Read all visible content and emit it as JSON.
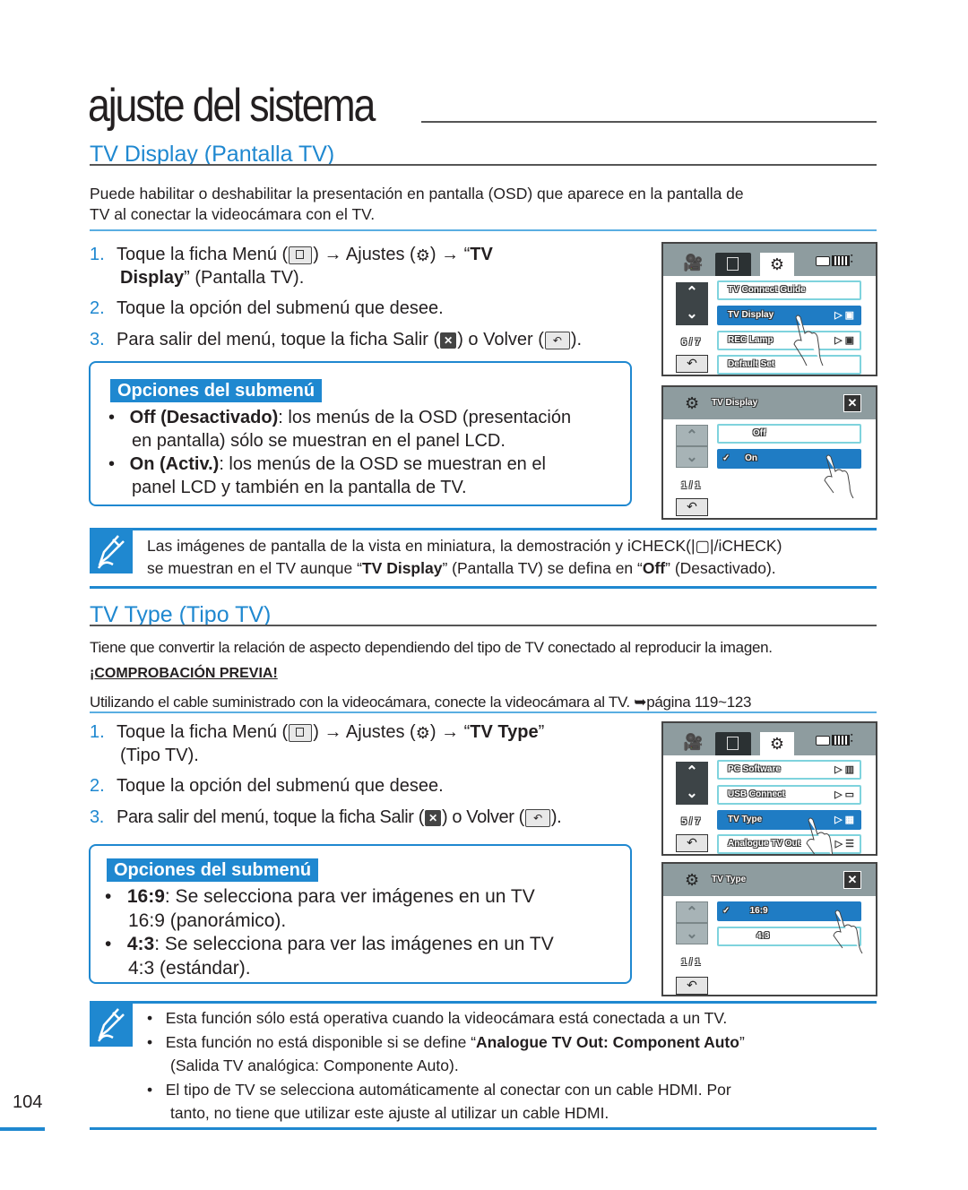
{
  "page": {
    "title": "ajuste del sistema",
    "number": "104"
  },
  "colors": {
    "accent": "#1f88d0",
    "selected": "#1f7cc4",
    "screen_header": "#8e9c9f"
  },
  "tv_display": {
    "title": "TV Display (Pantalla TV)",
    "intro": [
      "Puede habilitar o deshabilitar la presentación en pantalla (OSD) que aparece en la pantalla de",
      "TV al conectar la videocámara con el TV."
    ],
    "steps": [
      {
        "num": "1.",
        "a": "Toque la ficha Menú (",
        "b": ") → Ajustes (",
        "c": ") → “",
        "bold": "TV",
        "line2_bold": "Display",
        "line2": "” (Pantalla TV)."
      },
      {
        "num": "2.",
        "text": "Toque la opción del submenú que desee."
      },
      {
        "num": "3.",
        "a": "Para salir del menú, toque la ficha Salir (",
        "b": ") o Volver (",
        "c": ")."
      }
    ],
    "options": {
      "heading": "Opciones del submenú",
      "items": [
        {
          "bold": "Off (Desactivado)",
          "text": ": los menús de la OSD (presentación",
          "cont": "en pantalla) sólo se muestran en el panel LCD."
        },
        {
          "bold": "On (Activ.)",
          "text": ": los menús de la OSD se muestran en el",
          "cont": "panel LCD y también en la pantalla de TV."
        }
      ]
    },
    "note": {
      "line1": "Las imágenes de pantalla de la vista en miniatura, la demostración y iCHECK(|▢|/iCHECK)",
      "line2_a": "se muestran en el TV aunque “",
      "line2_b": "TV Display",
      "line2_c": "” (Pantalla TV) se defina en “",
      "line2_d": "Off",
      "line2_e": "” (Desactivado)."
    },
    "screen_menu": {
      "page": "6 / 7",
      "items": [
        "TV Connect Guide",
        "TV Display",
        "REC Lamp",
        "Default Set"
      ],
      "selected_index": 1,
      "right_icons": [
        "",
        "▷ ▣",
        "▷ ▣",
        ""
      ]
    },
    "screen_sub": {
      "title": "TV Display",
      "page": "1 / 1",
      "items": [
        {
          "label": "Off",
          "checked": false
        },
        {
          "label": "On",
          "checked": true
        }
      ]
    }
  },
  "tv_type": {
    "title": "TV Type (Tipo TV)",
    "intro": "Tiene que convertir la relación de aspecto dependiendo del tipo de TV conectado al reproducir la imagen.",
    "precheck_heading": "¡COMPROBACIÓN PREVIA!",
    "precheck_text": "Utilizando el cable suministrado con la videocámara, conecte la videocámara al TV. ➥página 119~123",
    "steps": [
      {
        "num": "1.",
        "a": "Toque la ficha Menú (",
        "b": ") → Ajustes (",
        "c": ") → “",
        "bold": "TV Type",
        "d": "”",
        "line2": "(Tipo TV)."
      },
      {
        "num": "2.",
        "text": "Toque la opción del submenú que desee."
      },
      {
        "num": "3.",
        "a": "Para salir del menú, toque la ficha Salir (",
        "b": ") o Volver (",
        "c": ")."
      }
    ],
    "options": {
      "heading": "Opciones del submenú",
      "items": [
        {
          "bold": "16:9",
          "text": ": Se selecciona para ver imágenes en un TV",
          "cont": "16:9 (panorámico)."
        },
        {
          "bold": "4:3",
          "text": ": Se selecciona para ver las imágenes en un TV",
          "cont": "4:3 (estándar)."
        }
      ]
    },
    "notes": [
      {
        "text": "Esta función sólo está operativa cuando la videocámara está conectada a un TV."
      },
      {
        "a": "Esta función no está disponible si se define “",
        "bold": "Analogue TV Out: Component Auto",
        "b": "”",
        "cont": "(Salida TV analógica: Componente Auto)."
      },
      {
        "text": "El tipo de TV se selecciona automáticamente al conectar con un cable HDMI. Por",
        "cont": "tanto, no tiene que utilizar este ajuste al utilizar un cable HDMI."
      }
    ],
    "screen_menu": {
      "page": "5 / 7",
      "items": [
        "PC Software",
        "USB Connect",
        "TV Type",
        "Analogue TV Out"
      ],
      "selected_index": 2,
      "right_icons": [
        "▷ ▥",
        "▷ ▭",
        "▷ ▦",
        "▷ ☰"
      ]
    },
    "screen_sub": {
      "title": "TV Type",
      "page": "1 / 1",
      "items": [
        {
          "label": "16:9",
          "checked": true
        },
        {
          "label": "4:3",
          "checked": false
        }
      ]
    }
  },
  "icons": {
    "check": "✓",
    "close": "✕",
    "back": "↶",
    "up": "⌃",
    "down": "⌄",
    "gear": "⚙",
    "menu": "☰",
    "arrow": "→"
  }
}
